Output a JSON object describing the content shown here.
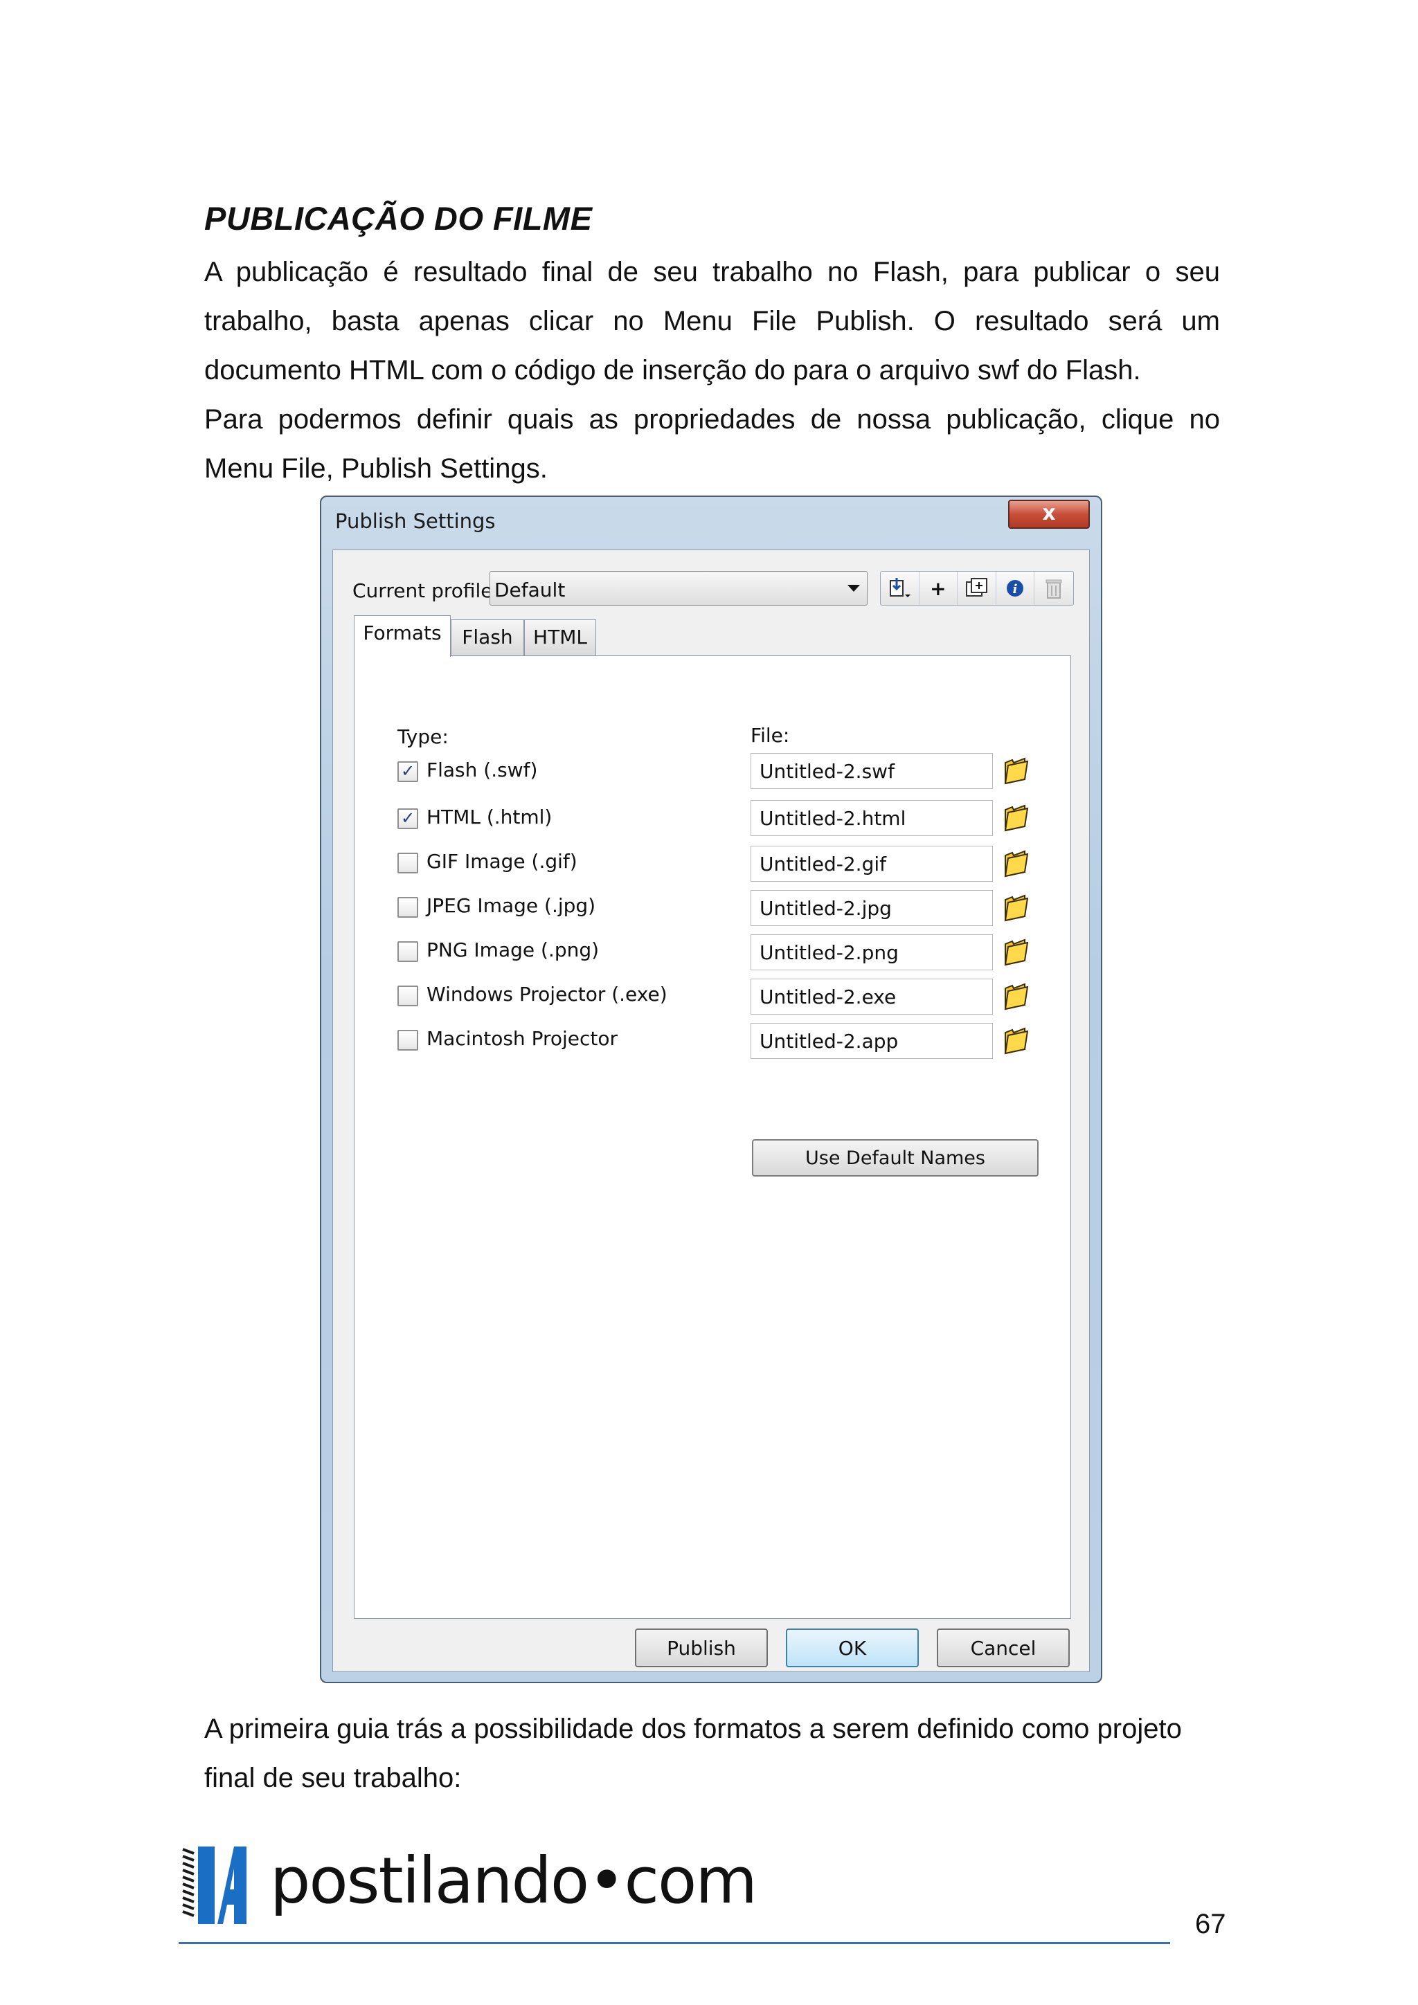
{
  "page": {
    "title": "PUBLICAÇÃO DO FILME",
    "paragraph_1": "A publicação é resultado final de seu trabalho no Flash, para publicar o seu trabalho, basta apenas clicar no Menu File Publish. O resultado será um documento HTML com o código de inserção do para o arquivo swf do Flash.",
    "paragraph_2": "Para podermos definir quais as propriedades de nossa publicação, clique no Menu File, Publish Settings.",
    "paragraph_3": "A primeira guia trás a possibilidade dos formatos a serem definido como projeto final de seu trabalho:",
    "page_number": "67"
  },
  "dialog": {
    "title": "Publish Settings",
    "close_label": "x",
    "profile_label": "Current profile:",
    "profile_value": "Default",
    "tabs": [
      "Formats",
      "Flash",
      "HTML"
    ],
    "type_header": "Type:",
    "file_header": "File:",
    "formats": [
      {
        "label": "Flash  (.swf)",
        "checked": true,
        "file": "Untitled-2.swf"
      },
      {
        "label": "HTML  (.html)",
        "checked": true,
        "file": "Untitled-2.html"
      },
      {
        "label": "GIF Image (.gif)",
        "checked": false,
        "file": "Untitled-2.gif"
      },
      {
        "label": "JPEG Image (.jpg)",
        "checked": false,
        "file": "Untitled-2.jpg"
      },
      {
        "label": "PNG Image (.png)",
        "checked": false,
        "file": "Untitled-2.png"
      },
      {
        "label": "Windows Projector (.exe)",
        "checked": false,
        "file": "Untitled-2.exe"
      },
      {
        "label": "Macintosh Projector",
        "checked": false,
        "file": "Untitled-2.app"
      }
    ],
    "default_names_label": "Use Default Names",
    "buttons": {
      "publish": "Publish",
      "ok": "OK",
      "cancel": "Cancel"
    }
  },
  "footer": {
    "logo_text": "postilando•com",
    "accent_color": "#1a6fc4"
  }
}
